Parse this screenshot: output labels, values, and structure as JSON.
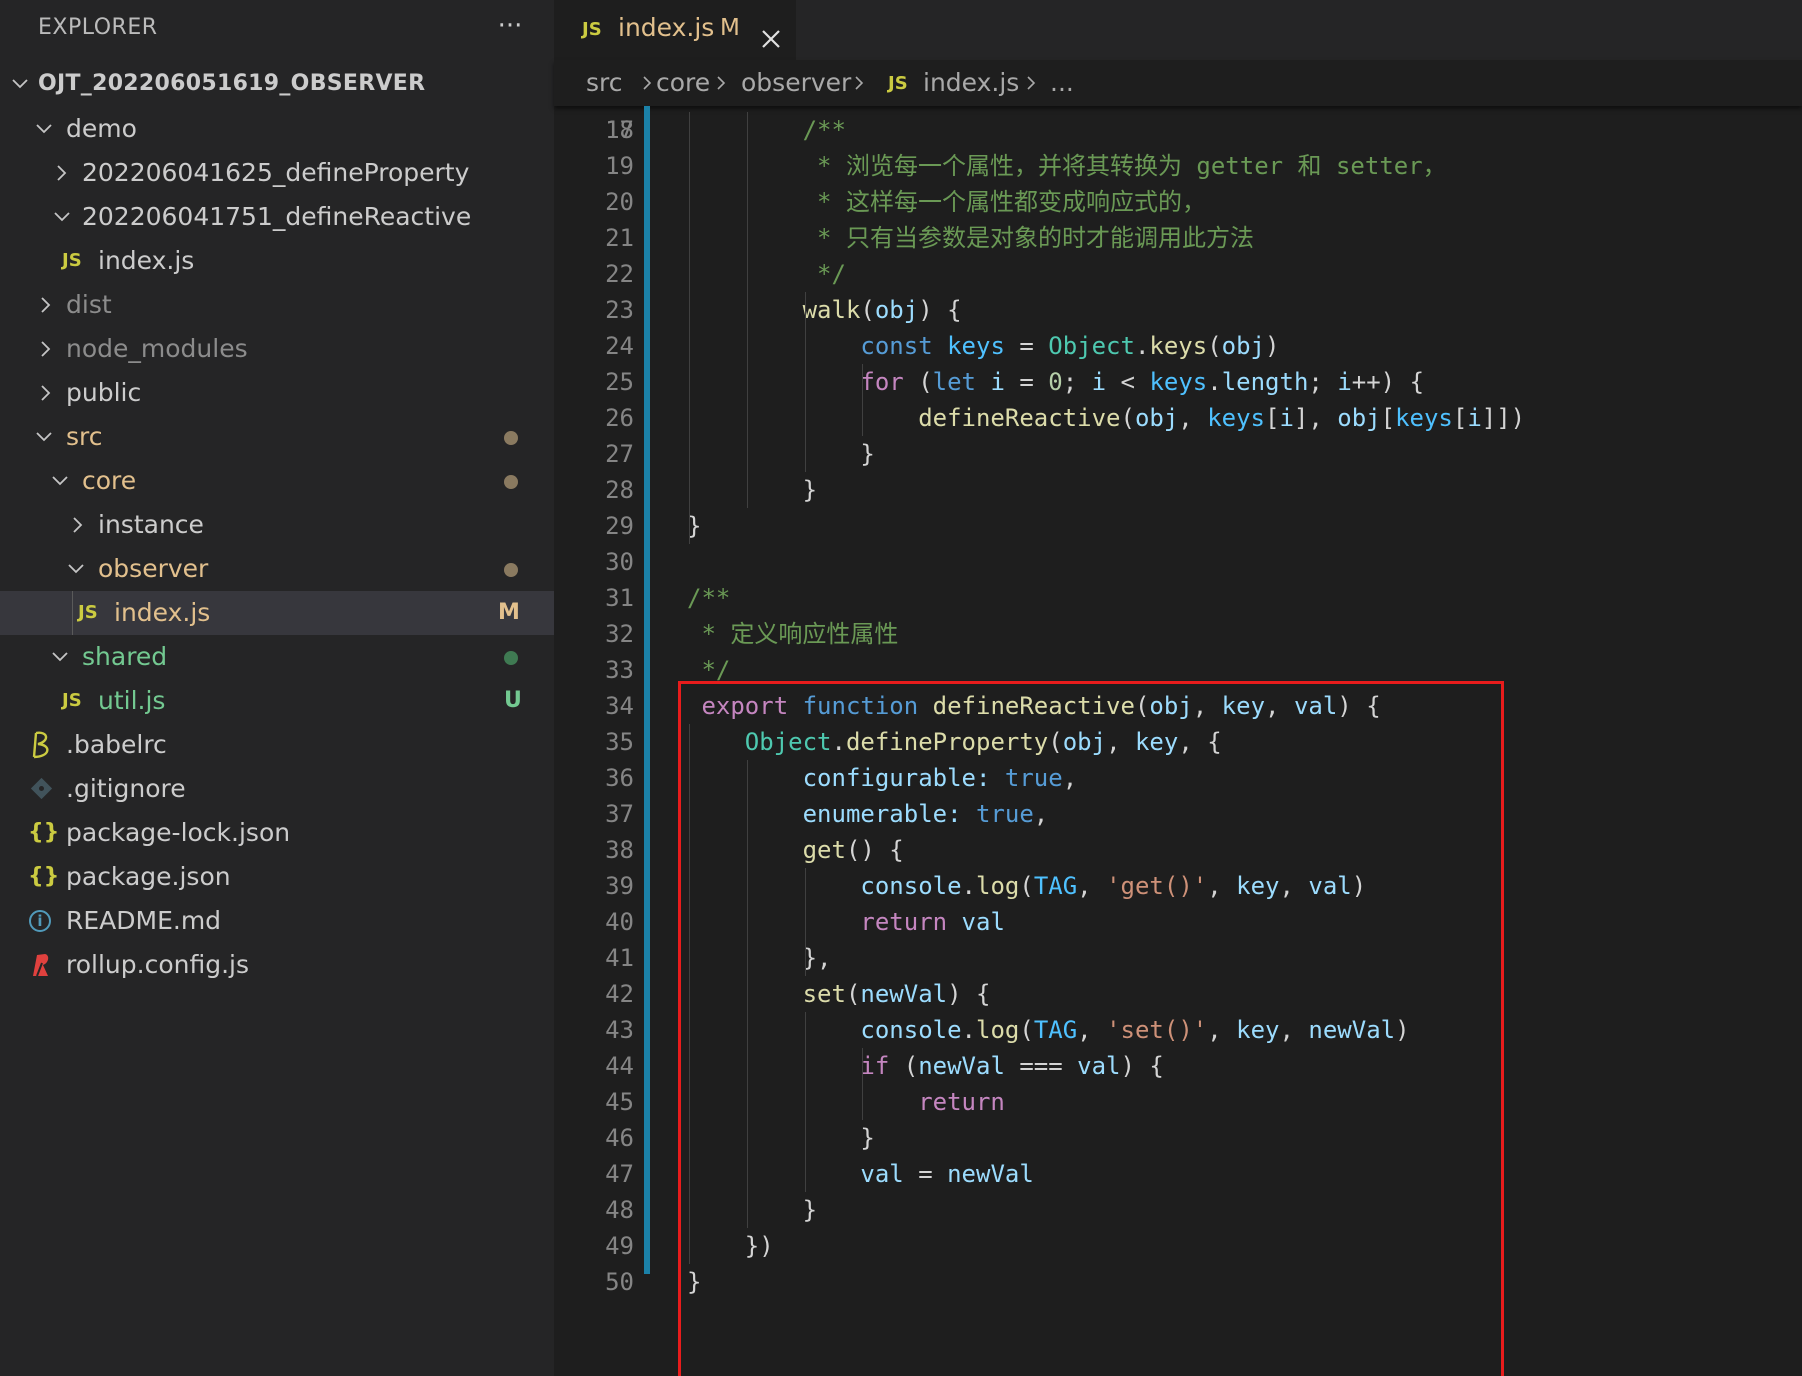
{
  "explorer": {
    "title": "EXPLORER",
    "more_label": "···",
    "root": "OJT_202206051619_OBSERVER",
    "items": [
      {
        "label": "demo",
        "kind": "folder-open"
      },
      {
        "label": "202206041625_defineProperty",
        "kind": "folder-closed"
      },
      {
        "label": "202206041751_defineReactive",
        "kind": "folder-open"
      },
      {
        "label": "index.js",
        "kind": "js-file",
        "icon_text": "JS"
      },
      {
        "label": "dist",
        "kind": "folder-closed"
      },
      {
        "label": "node_modules",
        "kind": "folder-closed"
      },
      {
        "label": "public",
        "kind": "folder-closed"
      },
      {
        "label": "src",
        "kind": "folder-open"
      },
      {
        "label": "core",
        "kind": "folder-open"
      },
      {
        "label": "instance",
        "kind": "folder-closed"
      },
      {
        "label": "observer",
        "kind": "folder-open"
      },
      {
        "label": "index.js",
        "kind": "js-file",
        "icon_text": "JS",
        "decoration": "M"
      },
      {
        "label": "shared",
        "kind": "folder-open"
      },
      {
        "label": "util.js",
        "kind": "js-file",
        "icon_text": "JS",
        "decoration": "U"
      },
      {
        "label": ".babelrc",
        "kind": "babel-file"
      },
      {
        "label": ".gitignore",
        "kind": "git-file"
      },
      {
        "label": "package-lock.json",
        "kind": "json-file",
        "icon_text": "{}"
      },
      {
        "label": "package.json",
        "kind": "json-file",
        "icon_text": "{}"
      },
      {
        "label": "README.md",
        "kind": "info-file",
        "icon_text": "i"
      },
      {
        "label": "rollup.config.js",
        "kind": "rollup-file"
      }
    ]
  },
  "tab": {
    "icon_text": "JS",
    "name": "index.js",
    "modified": "M"
  },
  "breadcrumb": {
    "parts": [
      "src",
      "core",
      "observer",
      "index.js",
      "..."
    ],
    "file_icon_text": "JS"
  },
  "colors": {
    "modified": "#e2c08d",
    "untracked": "#73c991",
    "js_icon": "#cbcb41",
    "highlight_box": "#e81c1c",
    "git_change_bar": "#1b81a8"
  },
  "code": {
    "partial_top_line": "17",
    "lines": [
      {
        "n": "18",
        "tokens": [
          [
            "c-txt",
            "        "
          ],
          [
            "c-com",
            "/**"
          ]
        ]
      },
      {
        "n": "19",
        "tokens": [
          [
            "c-txt",
            "         "
          ],
          [
            "c-com",
            "* 浏览每一个属性，并将其转换为 getter 和 setter，"
          ]
        ]
      },
      {
        "n": "20",
        "tokens": [
          [
            "c-txt",
            "         "
          ],
          [
            "c-com",
            "* 这样每一个属性都变成响应式的，"
          ]
        ]
      },
      {
        "n": "21",
        "tokens": [
          [
            "c-txt",
            "         "
          ],
          [
            "c-com",
            "* 只有当参数是对象的时才能调用此方法"
          ]
        ]
      },
      {
        "n": "22",
        "tokens": [
          [
            "c-txt",
            "         "
          ],
          [
            "c-com",
            "*/"
          ]
        ]
      },
      {
        "n": "23",
        "tokens": [
          [
            "c-txt",
            "        "
          ],
          [
            "c-fn",
            "walk"
          ],
          [
            "c-txt",
            "("
          ],
          [
            "c-var",
            "obj"
          ],
          [
            "c-txt",
            ") {"
          ]
        ]
      },
      {
        "n": "24",
        "tokens": [
          [
            "c-txt",
            "            "
          ],
          [
            "c-kw",
            "const"
          ],
          [
            "c-txt",
            " "
          ],
          [
            "c-cst",
            "keys"
          ],
          [
            "c-txt",
            " = "
          ],
          [
            "c-cls",
            "Object"
          ],
          [
            "c-txt",
            "."
          ],
          [
            "c-fn",
            "keys"
          ],
          [
            "c-txt",
            "("
          ],
          [
            "c-var",
            "obj"
          ],
          [
            "c-txt",
            ")"
          ]
        ]
      },
      {
        "n": "25",
        "tokens": [
          [
            "c-txt",
            "            "
          ],
          [
            "c-ctl",
            "for"
          ],
          [
            "c-txt",
            " ("
          ],
          [
            "c-kw",
            "let"
          ],
          [
            "c-txt",
            " "
          ],
          [
            "c-var",
            "i"
          ],
          [
            "c-txt",
            " = "
          ],
          [
            "c-num",
            "0"
          ],
          [
            "c-txt",
            "; "
          ],
          [
            "c-var",
            "i"
          ],
          [
            "c-txt",
            " < "
          ],
          [
            "c-cst",
            "keys"
          ],
          [
            "c-txt",
            "."
          ],
          [
            "c-var",
            "length"
          ],
          [
            "c-txt",
            "; "
          ],
          [
            "c-var",
            "i"
          ],
          [
            "c-txt",
            "++) {"
          ]
        ]
      },
      {
        "n": "26",
        "tokens": [
          [
            "c-txt",
            "                "
          ],
          [
            "c-fn",
            "defineReactive"
          ],
          [
            "c-txt",
            "("
          ],
          [
            "c-var",
            "obj"
          ],
          [
            "c-txt",
            ", "
          ],
          [
            "c-cst",
            "keys"
          ],
          [
            "c-txt",
            "["
          ],
          [
            "c-var",
            "i"
          ],
          [
            "c-txt",
            "], "
          ],
          [
            "c-var",
            "obj"
          ],
          [
            "c-txt",
            "["
          ],
          [
            "c-cst",
            "keys"
          ],
          [
            "c-txt",
            "["
          ],
          [
            "c-var",
            "i"
          ],
          [
            "c-txt",
            "]])"
          ]
        ]
      },
      {
        "n": "27",
        "tokens": [
          [
            "c-txt",
            "            }"
          ]
        ]
      },
      {
        "n": "28",
        "tokens": [
          [
            "c-txt",
            "        }"
          ]
        ]
      },
      {
        "n": "29",
        "tokens": [
          [
            "c-txt",
            "}"
          ]
        ]
      },
      {
        "n": "30",
        "tokens": []
      },
      {
        "n": "31",
        "tokens": [
          [
            "c-com",
            "/**"
          ]
        ]
      },
      {
        "n": "32",
        "tokens": [
          [
            "c-txt",
            " "
          ],
          [
            "c-com",
            "* 定义响应性属性"
          ]
        ]
      },
      {
        "n": "33",
        "tokens": [
          [
            "c-txt",
            " "
          ],
          [
            "c-com",
            "*/"
          ]
        ]
      },
      {
        "n": "34",
        "tokens": [
          [
            "c-txt",
            " "
          ],
          [
            "c-ctl",
            "export"
          ],
          [
            "c-txt",
            " "
          ],
          [
            "c-kw",
            "function"
          ],
          [
            "c-txt",
            " "
          ],
          [
            "c-fn",
            "defineReactive"
          ],
          [
            "c-txt",
            "("
          ],
          [
            "c-var",
            "obj"
          ],
          [
            "c-txt",
            ", "
          ],
          [
            "c-var",
            "key"
          ],
          [
            "c-txt",
            ", "
          ],
          [
            "c-var",
            "val"
          ],
          [
            "c-txt",
            ") {"
          ]
        ]
      },
      {
        "n": "35",
        "tokens": [
          [
            "c-txt",
            "    "
          ],
          [
            "c-cls",
            "Object"
          ],
          [
            "c-txt",
            "."
          ],
          [
            "c-fn",
            "defineProperty"
          ],
          [
            "c-txt",
            "("
          ],
          [
            "c-var",
            "obj"
          ],
          [
            "c-txt",
            ", "
          ],
          [
            "c-var",
            "key"
          ],
          [
            "c-txt",
            ", {"
          ]
        ]
      },
      {
        "n": "36",
        "tokens": [
          [
            "c-txt",
            "        "
          ],
          [
            "c-var",
            "configurable:"
          ],
          [
            "c-txt",
            " "
          ],
          [
            "c-kw",
            "true"
          ],
          [
            "c-txt",
            ","
          ]
        ]
      },
      {
        "n": "37",
        "tokens": [
          [
            "c-txt",
            "        "
          ],
          [
            "c-var",
            "enumerable:"
          ],
          [
            "c-txt",
            " "
          ],
          [
            "c-kw",
            "true"
          ],
          [
            "c-txt",
            ","
          ]
        ]
      },
      {
        "n": "38",
        "tokens": [
          [
            "c-txt",
            "        "
          ],
          [
            "c-fn",
            "get"
          ],
          [
            "c-txt",
            "() {"
          ]
        ]
      },
      {
        "n": "39",
        "tokens": [
          [
            "c-txt",
            "            "
          ],
          [
            "c-var",
            "console"
          ],
          [
            "c-txt",
            "."
          ],
          [
            "c-fn",
            "log"
          ],
          [
            "c-txt",
            "("
          ],
          [
            "c-cst",
            "TAG"
          ],
          [
            "c-txt",
            ", "
          ],
          [
            "c-str",
            "'get()'"
          ],
          [
            "c-txt",
            ", "
          ],
          [
            "c-var",
            "key"
          ],
          [
            "c-txt",
            ", "
          ],
          [
            "c-var",
            "val"
          ],
          [
            "c-txt",
            ")"
          ]
        ]
      },
      {
        "n": "40",
        "tokens": [
          [
            "c-txt",
            "            "
          ],
          [
            "c-ctl",
            "return"
          ],
          [
            "c-txt",
            " "
          ],
          [
            "c-var",
            "val"
          ]
        ]
      },
      {
        "n": "41",
        "tokens": [
          [
            "c-txt",
            "        },"
          ]
        ]
      },
      {
        "n": "42",
        "tokens": [
          [
            "c-txt",
            "        "
          ],
          [
            "c-fn",
            "set"
          ],
          [
            "c-txt",
            "("
          ],
          [
            "c-var",
            "newVal"
          ],
          [
            "c-txt",
            ") {"
          ]
        ]
      },
      {
        "n": "43",
        "tokens": [
          [
            "c-txt",
            "            "
          ],
          [
            "c-var",
            "console"
          ],
          [
            "c-txt",
            "."
          ],
          [
            "c-fn",
            "log"
          ],
          [
            "c-txt",
            "("
          ],
          [
            "c-cst",
            "TAG"
          ],
          [
            "c-txt",
            ", "
          ],
          [
            "c-str",
            "'set()'"
          ],
          [
            "c-txt",
            ", "
          ],
          [
            "c-var",
            "key"
          ],
          [
            "c-txt",
            ", "
          ],
          [
            "c-var",
            "newVal"
          ],
          [
            "c-txt",
            ")"
          ]
        ]
      },
      {
        "n": "44",
        "tokens": [
          [
            "c-txt",
            "            "
          ],
          [
            "c-ctl",
            "if"
          ],
          [
            "c-txt",
            " ("
          ],
          [
            "c-var",
            "newVal"
          ],
          [
            "c-txt",
            " === "
          ],
          [
            "c-var",
            "val"
          ],
          [
            "c-txt",
            ") {"
          ]
        ]
      },
      {
        "n": "45",
        "tokens": [
          [
            "c-txt",
            "                "
          ],
          [
            "c-ctl",
            "return"
          ]
        ]
      },
      {
        "n": "46",
        "tokens": [
          [
            "c-txt",
            "            }"
          ]
        ]
      },
      {
        "n": "47",
        "tokens": [
          [
            "c-txt",
            "            "
          ],
          [
            "c-var",
            "val"
          ],
          [
            "c-txt",
            " = "
          ],
          [
            "c-var",
            "newVal"
          ]
        ]
      },
      {
        "n": "48",
        "tokens": [
          [
            "c-txt",
            "        }"
          ]
        ]
      },
      {
        "n": "49",
        "tokens": [
          [
            "c-txt",
            "    })"
          ]
        ]
      },
      {
        "n": "50",
        "tokens": [
          [
            "c-txt",
            "}"
          ]
        ]
      }
    ]
  }
}
